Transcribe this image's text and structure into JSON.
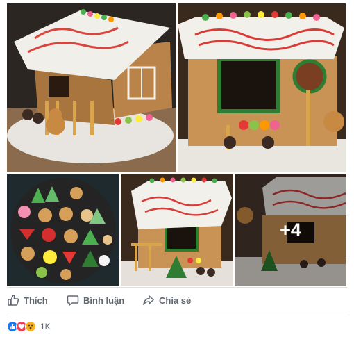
{
  "post": {
    "more_photos_label": "+4"
  },
  "actions": {
    "like_label": "Thích",
    "comment_label": "Bình luận",
    "share_label": "Chia sẻ"
  },
  "reactions": {
    "icons": [
      "like-icon",
      "love-icon",
      "wow-icon"
    ],
    "count": "1K"
  },
  "colors": {
    "like": "#1877f2",
    "love": "#f33e58",
    "wow": "#f7b125",
    "text": "#606770",
    "divider": "#dddfe2"
  }
}
